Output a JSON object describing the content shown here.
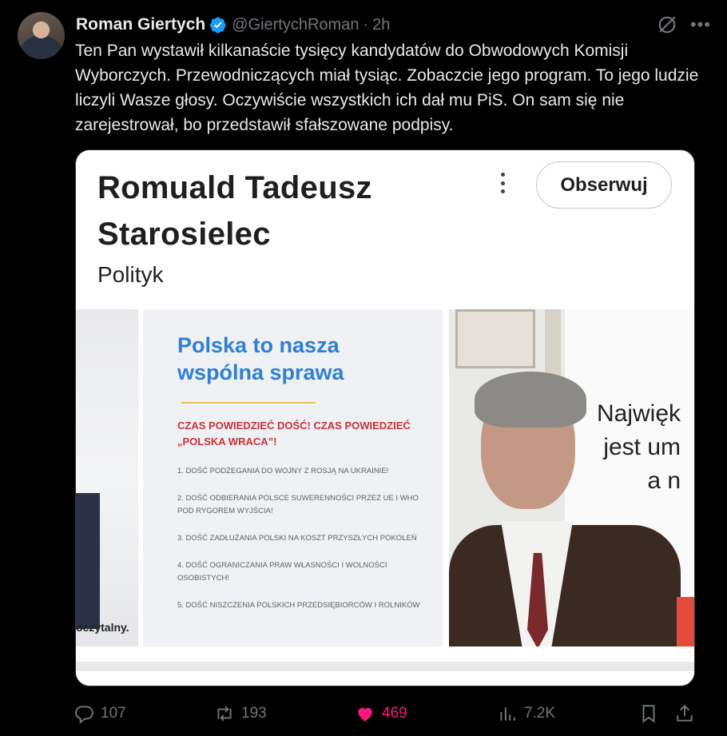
{
  "author": {
    "name": "Roman Giertych",
    "handle": "@GiertychRoman",
    "time": "2h"
  },
  "tweet": {
    "text": "Ten Pan wystawił kilkanaście tysięcy kandydatów do Obwodowych Komisji Wyborczych. Przewodniczących miał tysiąc. Zobaczcie jego program. To jego ludzie liczyli Wasze głosy. Oczywiście wszystkich ich dał mu PiS. On sam się nie zarejestrował, bo przedstawił sfałszowane podpisy."
  },
  "card": {
    "title": "Romuald Tadeusz Starosielec",
    "subtitle": "Polityk",
    "follow_label": "Obserwuj",
    "left_caption": "oczytalny.",
    "mid": {
      "heading_1": "Polska to nasza",
      "heading_2": "wspólna sprawa",
      "red_text": "CZAS POWIEDZIEĆ DOŚĆ! CZAS POWIEDZIEĆ „POLSKA WRACA”!",
      "items": [
        "1. DOŚĆ PODŻEGANIA DO WOJNY Z ROSJĄ NA UKRAINIE!",
        "2. DOŚĆ ODBIERANIA POLSCE SUWERENNOŚCI PRZEZ UE I WHO\nPOD RYGOREM WYJŚCIA!",
        "3. DOŚĆ ZADŁUŻANIA POLSKI NA KOSZT PRZYSZŁYCH POKOLEŃ",
        "4. DOŚĆ OGRANICZANIA PRAW WŁASNOŚCI I WOLNOŚCI\nOSOBISTYCH!",
        "5. DOŚĆ NISZCZENIA POLSKICH PRZEDSIĘBIORCÓW I ROLNIKÓW"
      ]
    },
    "right_banner": "Najwięk\njest um\na n"
  },
  "actions": {
    "replies": "107",
    "reposts": "193",
    "likes": "469",
    "views": "7.2K"
  },
  "colors": {
    "background": "#000000",
    "text": "#e7e9ea",
    "muted": "#71767b",
    "like": "#f91880",
    "verified": "#1d9bf0"
  }
}
